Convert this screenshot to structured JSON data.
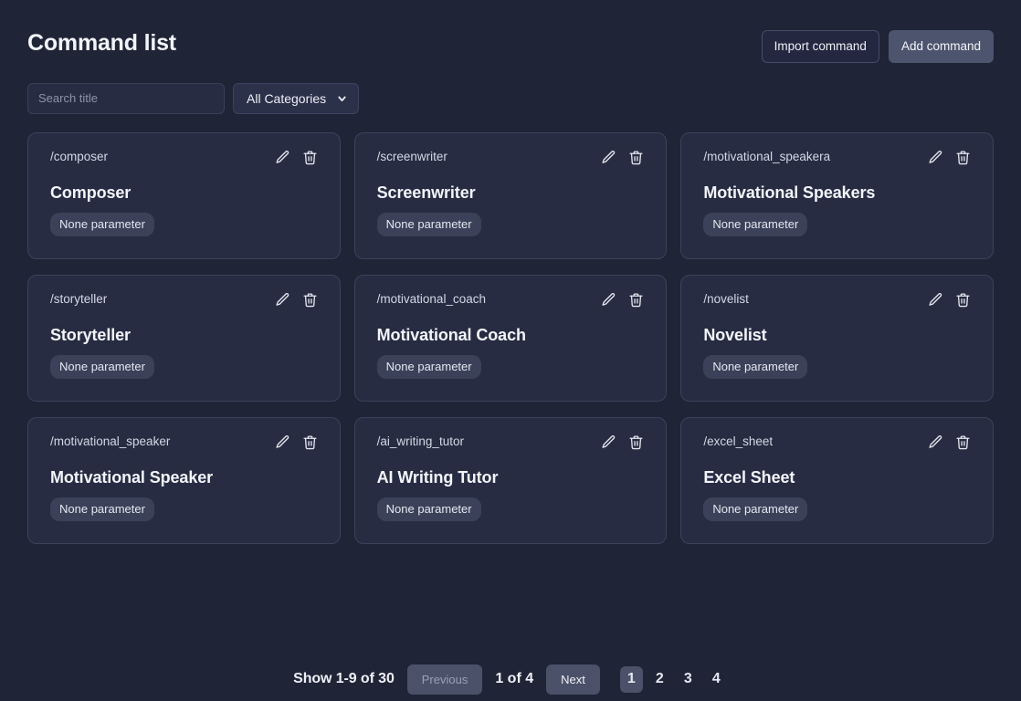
{
  "header": {
    "title": "Command list",
    "import_label": "Import command",
    "add_label": "Add command"
  },
  "filters": {
    "search_placeholder": "Search title",
    "search_value": "",
    "category_selected": "All Categories",
    "category_options": [
      "All Categories"
    ],
    "chevron_icon": "chevron-down-icon"
  },
  "card_icons": {
    "edit": "pencil-icon",
    "delete": "trash-icon"
  },
  "cards": [
    {
      "slug": "/composer",
      "title": "Composer",
      "badge": "None parameter"
    },
    {
      "slug": "/screenwriter",
      "title": "Screenwriter",
      "badge": "None parameter"
    },
    {
      "slug": "/motivational_speakera",
      "title": "Motivational Speakers",
      "badge": "None parameter"
    },
    {
      "slug": "/storyteller",
      "title": "Storyteller",
      "badge": "None parameter"
    },
    {
      "slug": "/motivational_coach",
      "title": "Motivational Coach",
      "badge": "None parameter"
    },
    {
      "slug": "/novelist",
      "title": "Novelist",
      "badge": "None parameter"
    },
    {
      "slug": "/motivational_speaker",
      "title": "Motivational Speaker",
      "badge": "None parameter"
    },
    {
      "slug": "/ai_writing_tutor",
      "title": "AI Writing Tutor",
      "badge": "None parameter"
    },
    {
      "slug": "/excel_sheet",
      "title": "Excel Sheet",
      "badge": "None parameter"
    }
  ],
  "pagination": {
    "status": "Show 1-9 of 30",
    "previous_label": "Previous",
    "next_label": "Next",
    "indicator": "1 of 4",
    "pages": [
      "1",
      "2",
      "3",
      "4"
    ],
    "active_page": "1"
  },
  "colors": {
    "page_background": "#1f2436",
    "card_background": "#272c42",
    "card_border": "#3c4259",
    "accent_button": "#4d546e",
    "badge_background": "#3b4158",
    "text_primary": "#f2f4fa",
    "text_muted": "#8c93ab"
  }
}
